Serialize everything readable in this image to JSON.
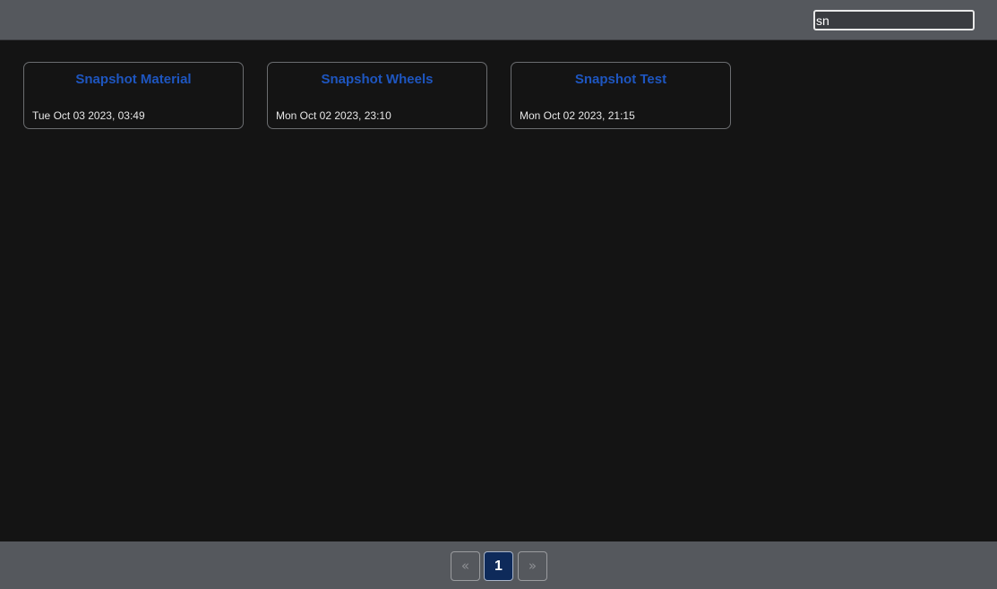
{
  "search": {
    "value": "sn",
    "placeholder": ""
  },
  "cards": [
    {
      "title": "Snapshot Material",
      "date": "Tue Oct 03 2023, 03:49"
    },
    {
      "title": "Snapshot Wheels",
      "date": "Mon Oct 02 2023, 23:10"
    },
    {
      "title": "Snapshot Test",
      "date": "Mon Oct 02 2023, 21:15"
    }
  ],
  "pagination": {
    "prev_label": "«",
    "current_page": "1",
    "next_label": "»"
  },
  "colors": {
    "bar_background": "#55585d",
    "page_background": "#141414",
    "card_title": "#1e56c0",
    "active_page": "#0e2a5a"
  }
}
